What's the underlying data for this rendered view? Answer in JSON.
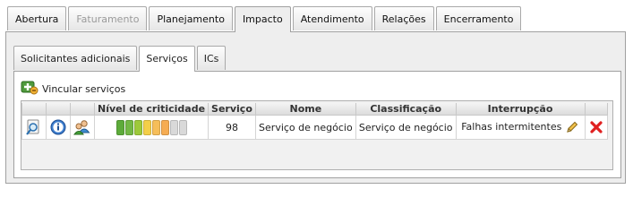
{
  "tabs": [
    "Abertura",
    "Faturamento",
    "Planejamento",
    "Impacto",
    "Atendimento",
    "Relações",
    "Encerramento"
  ],
  "subtabs": [
    "Solicitantes adicionais",
    "Serviços",
    "ICs"
  ],
  "link_services": "Vincular serviços",
  "table": {
    "headers": [
      "",
      "",
      "",
      "Nível de criticidade",
      "Serviço",
      "Nome",
      "Classificação",
      "Interrupção",
      ""
    ],
    "row": {
      "criticality_colors": [
        "#5dab3a",
        "#73b845",
        "#9dc93a",
        "#f4cf48",
        "#f6be5a",
        "#f6ac52",
        "#d9d9d9",
        "#d9d9d9"
      ],
      "service": "98",
      "name": "Serviço de negócio",
      "classification": "Serviço de negócio",
      "interruption": "Falhas intermitentes"
    }
  },
  "icons": [
    "add-service-icon",
    "search-icon",
    "info-icon",
    "users-icon",
    "edit-pencil-icon",
    "delete-icon"
  ],
  "colors": {
    "panel_bg": "#eeeeee",
    "border": "#a0a0a0",
    "delete_red": "#e02020"
  }
}
